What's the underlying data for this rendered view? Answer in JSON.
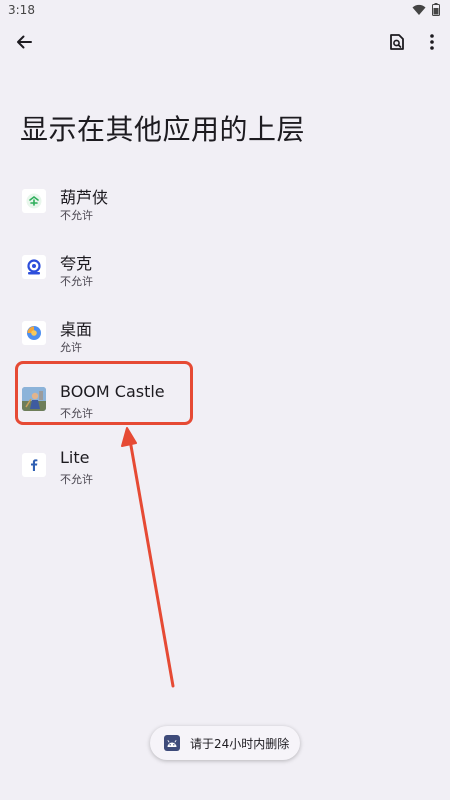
{
  "status_bar": {
    "time": "3:18",
    "icons": [
      "wifi-icon",
      "battery-icon"
    ]
  },
  "toolbar": {
    "back_icon": "arrow-back-icon",
    "search_icon": "search-in-page-icon",
    "more_icon": "more-vert-icon"
  },
  "page": {
    "title": "显示在其他应用的上层"
  },
  "apps": [
    {
      "name": "葫芦侠",
      "status": "不允许",
      "icon": "huluxia-icon"
    },
    {
      "name": "夸克",
      "status": "不允许",
      "icon": "quark-icon"
    },
    {
      "name": "桌面",
      "status": "允许",
      "icon": "launcher-icon"
    },
    {
      "name": "BOOM Castle",
      "status": "不允许",
      "icon": "boom-castle-icon"
    },
    {
      "name": "Lite",
      "status": "不允许",
      "icon": "facebook-lite-icon"
    }
  ],
  "annotation": {
    "highlight_color": "#E64A34",
    "highlighted_item": "BOOM Castle"
  },
  "toast": {
    "text": "请于24小时内删除",
    "icon": "android-icon"
  }
}
